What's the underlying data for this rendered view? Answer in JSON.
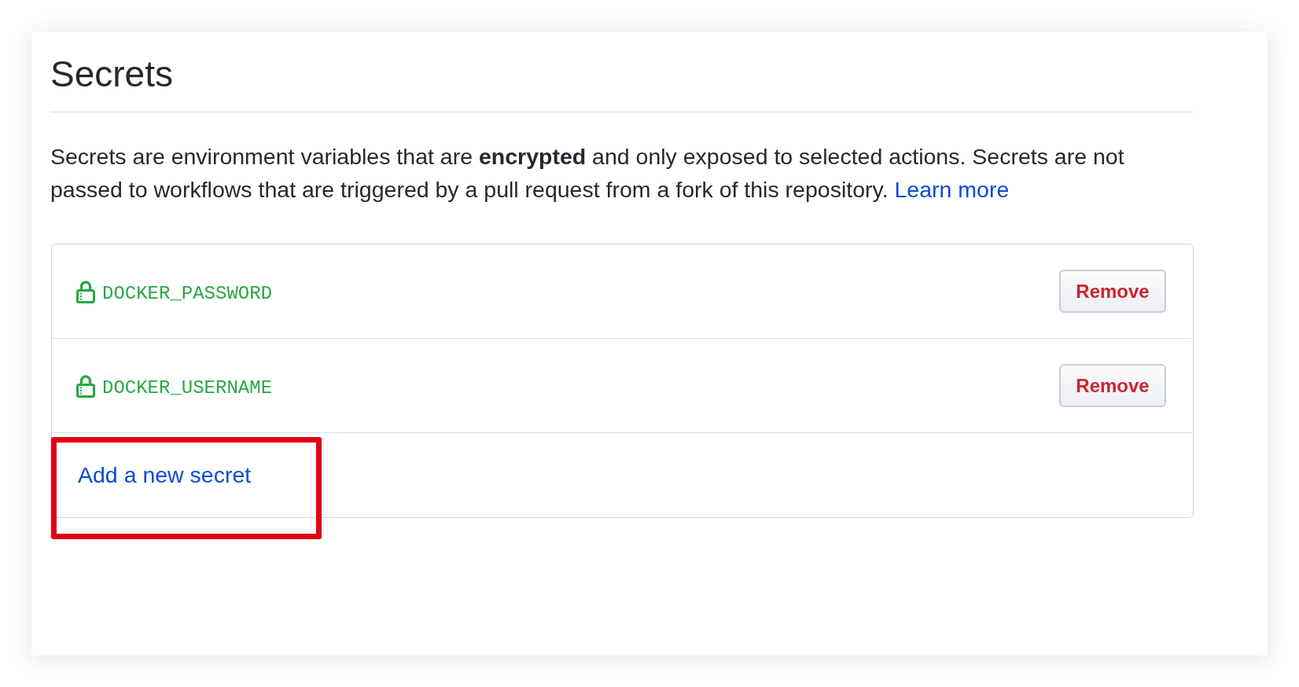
{
  "page": {
    "title": "Secrets"
  },
  "description": {
    "text": "Secrets are environment variables that are **encrypted** and only exposed to selected actions. Secrets are not passed to workflows that are triggered by a pull request from a fork of this repository.",
    "link": "Learn more"
  },
  "secrets": [
    {
      "name": "DOCKER_PASSWORD",
      "action": "Remove"
    },
    {
      "name": "DOCKER_USERNAME",
      "action": "Remove"
    }
  ],
  "add_secret": {
    "label": "Add a new secret",
    "highlighted": true
  }
}
